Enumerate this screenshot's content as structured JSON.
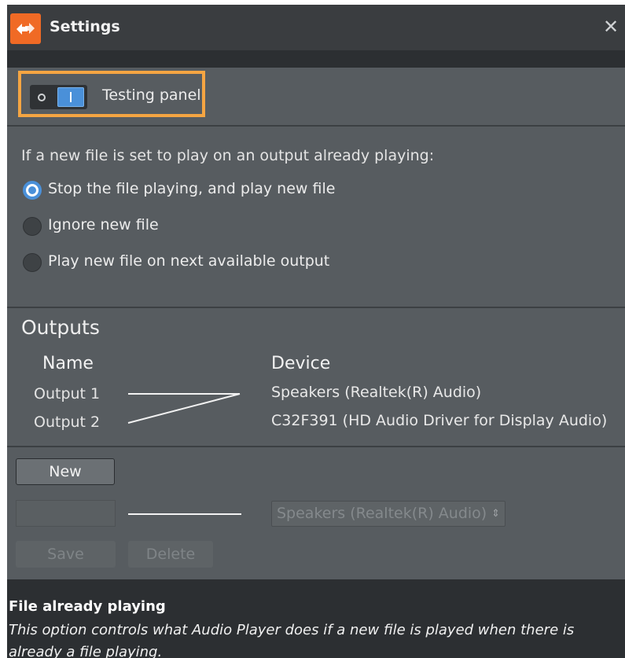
{
  "window": {
    "title": "Settings",
    "close_glyph": "✕",
    "app_icon": "app-logo-icon"
  },
  "testing_panel": {
    "label": "Testing panel",
    "enabled": true,
    "accent": "#f5a542"
  },
  "playback": {
    "question": "If a new file is set to play on an output already playing:",
    "options": [
      {
        "label": "Stop the file playing, and play new file",
        "checked": true
      },
      {
        "label": "Ignore new file",
        "checked": false
      },
      {
        "label": "Play new file on next available output",
        "checked": false
      }
    ]
  },
  "outputs": {
    "title": "Outputs",
    "name_header": "Name",
    "device_header": "Device",
    "rows": [
      {
        "name": "Output 1",
        "device": "Speakers (Realtek(R) Audio)"
      },
      {
        "name": "Output 2",
        "device": "C32F391 (HD Audio Driver for Display Audio)"
      }
    ]
  },
  "editor": {
    "new_label": "New",
    "name_value": "",
    "device_selected": "Speakers (Realtek(R) Audio)",
    "save_label": "Save",
    "delete_label": "Delete"
  },
  "help": {
    "title": "File already playing",
    "description": "This option controls what Audio Player does if a new file is played when there is already a file playing."
  },
  "colors": {
    "accent_blue": "#4a90d9",
    "brand_orange": "#f06a25"
  }
}
